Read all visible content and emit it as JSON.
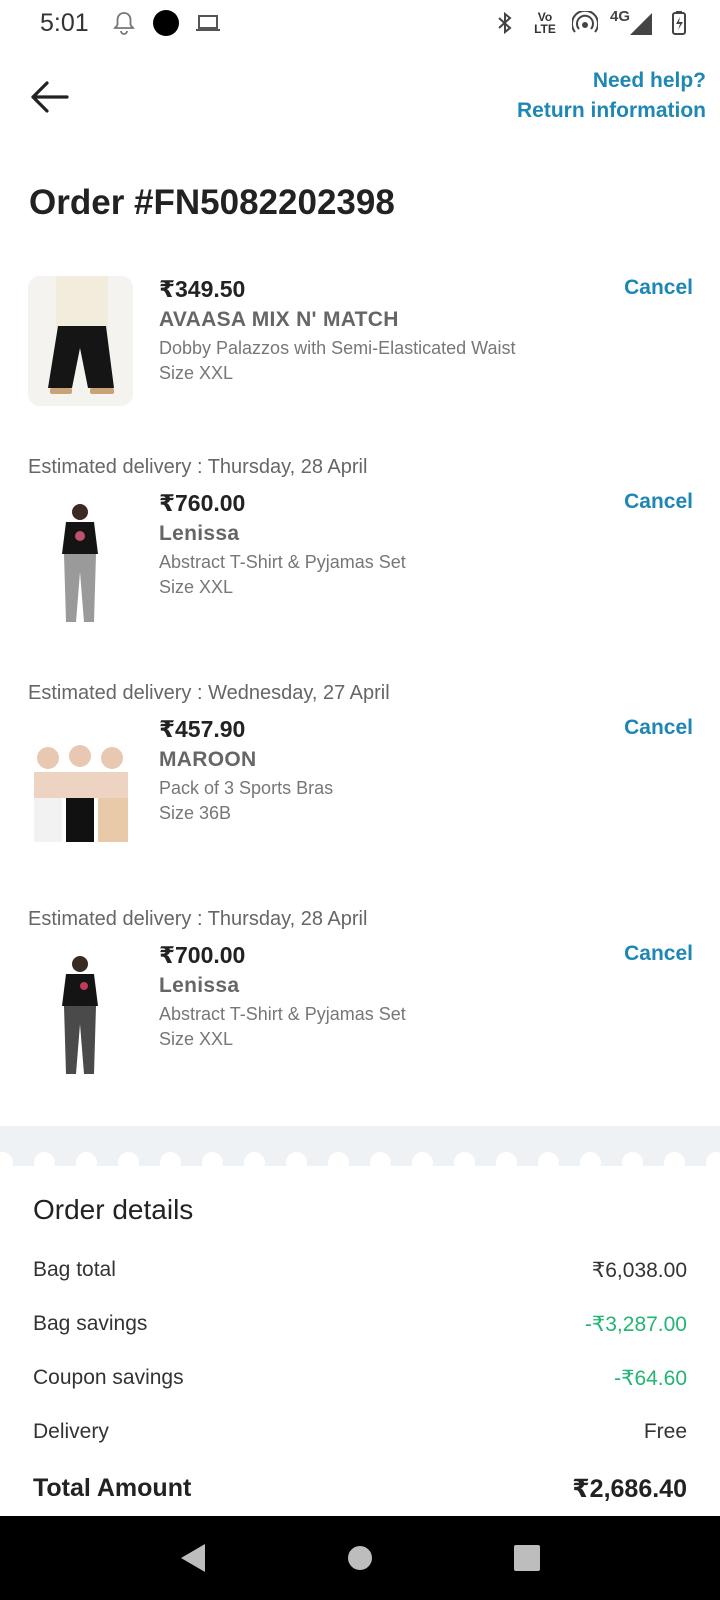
{
  "status_bar": {
    "time": "5:01",
    "volte_top": "Vo",
    "volte_bottom": "LTE",
    "network": "4G"
  },
  "header": {
    "need_help": "Need help?",
    "return_info": "Return information"
  },
  "order": {
    "title": "Order #FN5082202398"
  },
  "items": [
    {
      "estimated_delivery": "",
      "price": "₹349.50",
      "brand": "AVAASA MIX N' MATCH",
      "description": "Dobby Palazzos with Semi-Elasticated Waist",
      "size": "Size XXL",
      "action": "Cancel"
    },
    {
      "estimated_delivery": "Estimated delivery : Thursday, 28 April",
      "price": "₹760.00",
      "brand": "Lenissa",
      "description": "Abstract T-Shirt & Pyjamas Set",
      "size": "Size XXL",
      "action": "Cancel"
    },
    {
      "estimated_delivery": "Estimated delivery : Wednesday, 27 April",
      "price": "₹457.90",
      "brand": "MAROON",
      "description": "Pack of 3 Sports Bras",
      "size": "Size 36B",
      "action": "Cancel"
    },
    {
      "estimated_delivery": "Estimated delivery : Thursday, 28 April",
      "price": "₹700.00",
      "brand": "Lenissa",
      "description": "Abstract T-Shirt & Pyjamas Set",
      "size": "Size XXL",
      "action": "Cancel"
    }
  ],
  "details": {
    "title": "Order details",
    "rows": [
      {
        "label": "Bag total",
        "value": "₹6,038.00"
      },
      {
        "label": "Bag savings",
        "value": "-₹3,287.00"
      },
      {
        "label": "Coupon savings",
        "value": "-₹64.60"
      },
      {
        "label": "Delivery",
        "value": "Free"
      }
    ],
    "total_label": "Total Amount",
    "total_value": "₹2,686.40"
  },
  "colors": {
    "accent": "#1f87b5",
    "savings": "#22b573",
    "band": "#eef2f5"
  }
}
